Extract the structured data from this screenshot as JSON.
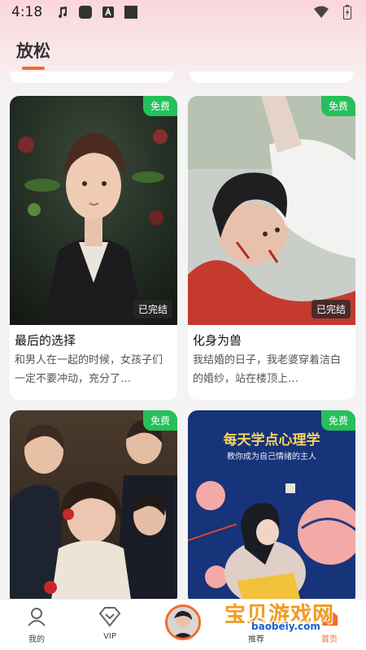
{
  "status_bar": {
    "time": "4:18"
  },
  "header": {
    "title": "放松"
  },
  "cards": [
    {
      "title": "最后的选择",
      "description": "和男人在一起的时候，女孩子们一定不要冲动，充分了…",
      "badge": "免费",
      "status": "已完结"
    },
    {
      "title": "化身为兽",
      "description": "我结婚的日子，我老婆穿着洁白的婚纱，站在楼顶上…",
      "badge": "免费",
      "status": "已完结"
    },
    {
      "title": "",
      "description": "",
      "badge": "免费",
      "status": ""
    },
    {
      "title": "",
      "description": "",
      "badge": "免费",
      "status": "",
      "cover_text": {
        "headline": "每天学点心理学",
        "subline": "教你成为自己情绪的主人"
      }
    }
  ],
  "nav": {
    "items": [
      {
        "label": "我的",
        "icon": "person-icon"
      },
      {
        "label": "VIP",
        "icon": "vip-diamond-icon"
      },
      {
        "label": "",
        "icon": "avatar-center"
      },
      {
        "label": "推荐",
        "icon": "recommend-icon"
      },
      {
        "label": "首页",
        "icon": "home-icon"
      }
    ]
  },
  "watermark": {
    "text": "宝贝游戏网",
    "url": "baobeiy.com"
  },
  "colors": {
    "accent": "#f06a2c",
    "free_badge": "#25c05a"
  }
}
